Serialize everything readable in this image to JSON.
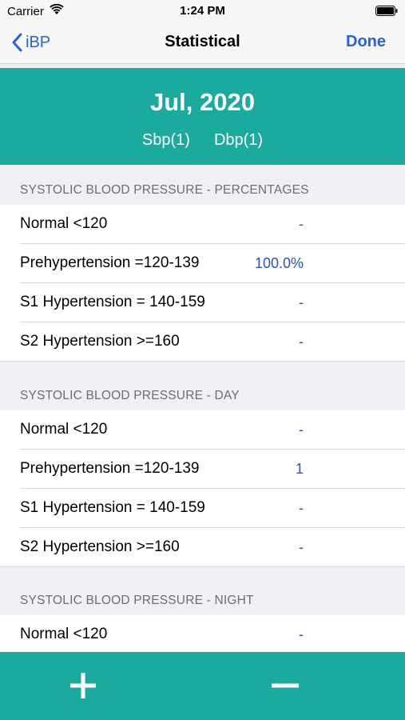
{
  "status_bar": {
    "carrier": "Carrier",
    "time": "1:24 PM"
  },
  "nav": {
    "back_label": "iBP",
    "title": "Statistical",
    "done_label": "Done"
  },
  "summary": {
    "month": "Jul, 2020",
    "sbp": "Sbp(1)",
    "dbp": "Dbp(1)"
  },
  "sections": [
    {
      "title": "SYSTOLIC BLOOD PRESSURE - PERCENTAGES",
      "rows": [
        {
          "label": "Normal <120",
          "value": "-"
        },
        {
          "label": "Prehypertension =120-139",
          "value": "100.0%"
        },
        {
          "label": "S1 Hypertension = 140-159",
          "value": "-"
        },
        {
          "label": "S2 Hypertension >=160",
          "value": "-"
        }
      ]
    },
    {
      "title": "SYSTOLIC BLOOD PRESSURE - DAY",
      "rows": [
        {
          "label": "Normal <120",
          "value": "-"
        },
        {
          "label": "Prehypertension =120-139",
          "value": "1"
        },
        {
          "label": "S1 Hypertension = 140-159",
          "value": "-"
        },
        {
          "label": "S2 Hypertension >=160",
          "value": "-"
        }
      ]
    },
    {
      "title": "SYSTOLIC BLOOD PRESSURE - NIGHT",
      "rows": [
        {
          "label": "Normal <120",
          "value": "-"
        }
      ]
    }
  ],
  "toolbar": {
    "add_icon": "plus-icon",
    "remove_icon": "minus-icon"
  },
  "colors": {
    "accent_teal": "#1aab9e",
    "link_blue": "#2a62d6",
    "value_blue": "#2a52c9"
  }
}
